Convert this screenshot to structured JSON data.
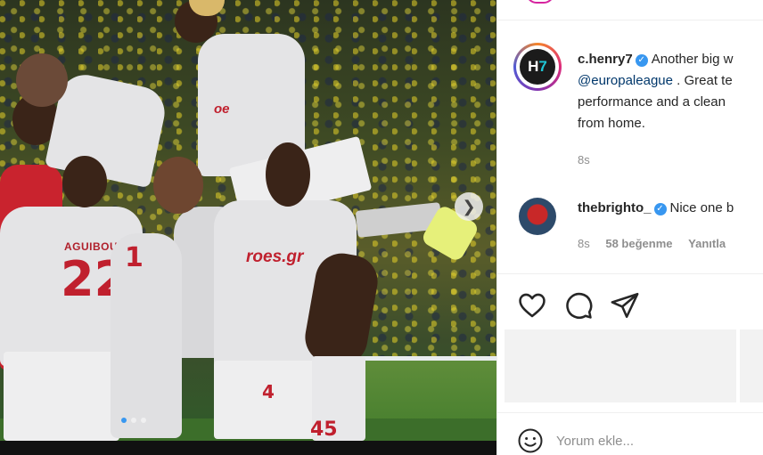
{
  "post": {
    "images_count": 3,
    "current_image": 1,
    "jersey": {
      "name_1": "AGUIBOU",
      "number_1": "22",
      "number_2": "4",
      "number_3": "45",
      "number_4": "1",
      "sponsor": "roes.gr",
      "sponsor_2": "oe"
    }
  },
  "caption": {
    "username": "c.henry7",
    "text_1": "Another big w",
    "mention": "@europaleague",
    "text_2": ". Great te",
    "text_3": "performance and a clean",
    "text_4": "from home.",
    "time": "8s"
  },
  "comment": {
    "username": "thebrighto_",
    "text": "Nice one b",
    "time": "8s",
    "likes": "58 beğenme",
    "reply": "Yanıtla"
  },
  "actions": {
    "like": "heart-icon",
    "comment": "comment-icon",
    "share": "share-icon"
  },
  "add_comment": {
    "placeholder": "Yorum ekle..."
  },
  "colors": {
    "verified": "#3897f0",
    "mention": "#00376b",
    "meta": "#8e8e8e",
    "carousel_active": "#3897f0"
  }
}
